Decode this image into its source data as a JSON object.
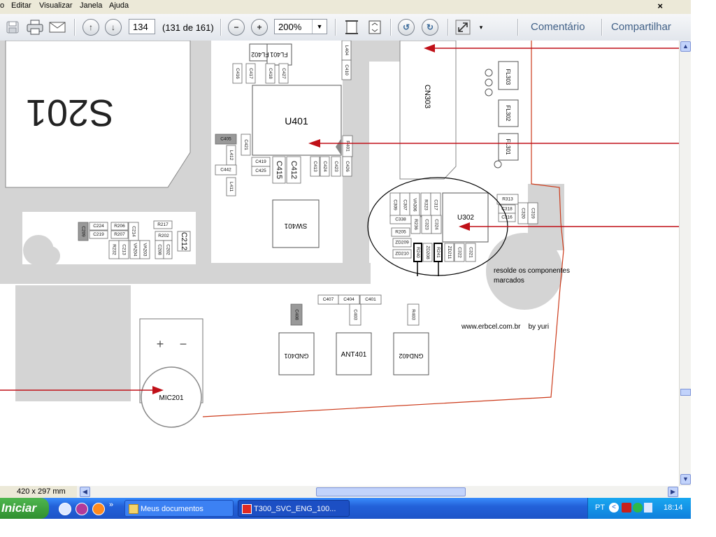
{
  "menu": {
    "items": [
      "o",
      "Editar",
      "Visualizar",
      "Janela",
      "Ajuda"
    ],
    "close_glyph": "×"
  },
  "toolbar": {
    "page_number": "134",
    "page_of": "(131 de 161)",
    "zoom": "200%",
    "comment_label": "Comentário",
    "share_label": "Compartilhar",
    "icons": [
      "save-icon",
      "print-icon",
      "email-icon",
      "prev-page-icon",
      "next-page-icon",
      "zoom-out-icon",
      "zoom-in-icon",
      "fit-page-icon",
      "fit-width-icon",
      "rotate-ccw-icon",
      "rotate-cw-icon",
      "fullscreen-icon",
      "more-tools-icon"
    ]
  },
  "document": {
    "big_label": "S201",
    "chips": {
      "u401": "U401",
      "u302": "U302",
      "cn303": "CN303",
      "sw401": "SW401",
      "mic201": "MIC201",
      "gnd401": "GND401",
      "ant401": "ANT401",
      "gnd402": "GND402",
      "fl402": "FL402",
      "fl401": "FL401",
      "fl303": "FL303",
      "fl302": "FL302",
      "fl301": "FL301"
    },
    "small_labels": [
      "C416",
      "C417",
      "C418",
      "C427",
      "L404",
      "C410",
      "C405",
      "C421",
      "R401",
      "L412",
      "C442",
      "C419",
      "C425",
      "C415",
      "C412",
      "C413",
      "C424",
      "C423",
      "C426",
      "L411",
      "R313",
      "C318",
      "C320",
      "C319",
      "C316",
      "C309",
      "C307",
      "VA306",
      "R323",
      "C317",
      "C338",
      "R236",
      "C323",
      "C324",
      "R205",
      "ZD209",
      "ZD210",
      "R240",
      "ZD208",
      "R241",
      "ZD211",
      "C322",
      "C321",
      "R217",
      "C212",
      "R202",
      "C208",
      "C202",
      "C209",
      "C224",
      "R206",
      "C214",
      "C219",
      "R207",
      "R232",
      "C213",
      "VA204",
      "VA203",
      "C407",
      "C404",
      "C401",
      "C408",
      "C403",
      "R403"
    ],
    "annotation_line1": "resolde os componentes",
    "annotation_line2": "marcados",
    "credit": "www.erbcel.com.br    by yuri"
  },
  "status": {
    "page_size": "420 x 297 mm"
  },
  "taskbar": {
    "start_label": "Iniciar",
    "tasks": [
      "Meus documentos",
      "T300_SVC_ENG_100..."
    ],
    "language": "PT",
    "clock": "18:14"
  },
  "colors": {
    "arrow": "#c01018",
    "board_edge": "#cc3a1a",
    "grey_fill": "#d4d4d4",
    "link": "#3f5f86"
  }
}
